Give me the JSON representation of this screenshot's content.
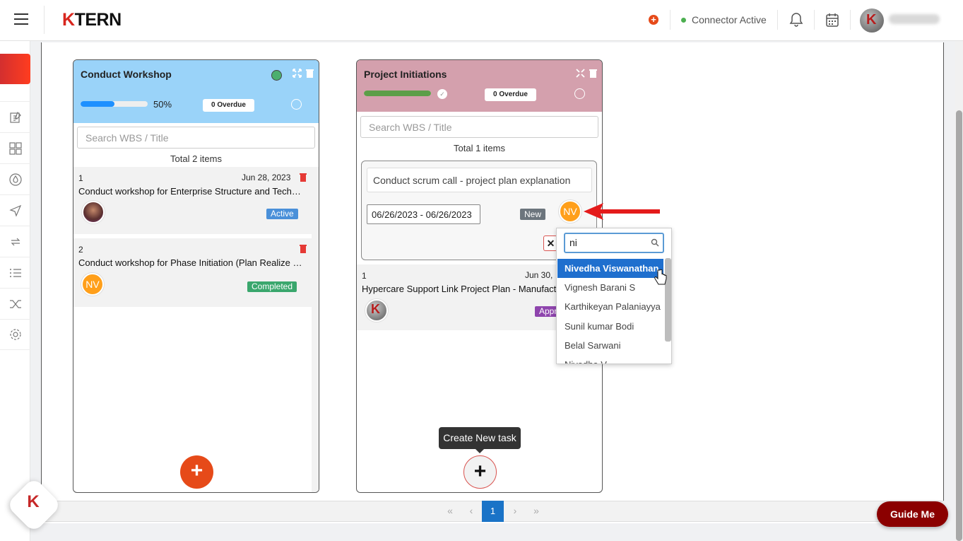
{
  "header": {
    "logo_k": "K",
    "logo_rest": "TERN",
    "connector_status": "Connector Active"
  },
  "columns": [
    {
      "title": "Conduct Workshop",
      "head_color": "#9ad3f9",
      "progress": 50,
      "progress_label": "50%",
      "overdue": "0 Overdue",
      "search_placeholder": "Search WBS / Title",
      "total": "Total 2 items",
      "cards": [
        {
          "num": "1",
          "date": "Jun 28, 2023",
          "title": "Conduct workshop for Enterprise Structure and Techni...",
          "status": "Active",
          "status_color": "#4a90d9"
        },
        {
          "num": "2",
          "date": "",
          "title": "Conduct workshop for Phase Initiation (Plan Realize Ph...",
          "status": "Completed",
          "status_color": "#3aa76d",
          "avatar": "NV"
        }
      ]
    },
    {
      "title": "Project Initiations",
      "head_color": "#d4a0ad",
      "progress": 100,
      "overdue": "0 Overdue",
      "search_placeholder": "Search WBS / Title",
      "total": "Total 1 items",
      "new_task": {
        "title_value": "Conduct scrum call - project plan explanation",
        "date_range": "06/26/2023 - 06/26/2023",
        "status": "New",
        "avatar": "NV"
      },
      "cards": [
        {
          "num": "1",
          "date": "Jun 30,",
          "title": "Hypercare Support Link Project Plan - Manufactu",
          "status": "Appr",
          "status_color": "#8e44ad"
        }
      ]
    }
  ],
  "assignee_dropdown": {
    "search_value": "ni",
    "options": [
      "Nivedha Viswanathan",
      "Vignesh Barani S",
      "Karthikeyan Palaniayya",
      "Sunil kumar Bodi",
      "Belal Sarwani",
      "Nivedha V"
    ]
  },
  "tooltip": "Create New task",
  "pagination": {
    "first": "«",
    "prev": "‹",
    "current": "1",
    "next": "›",
    "last": "»"
  },
  "guide_me": "Guide Me",
  "float_logo": "K"
}
